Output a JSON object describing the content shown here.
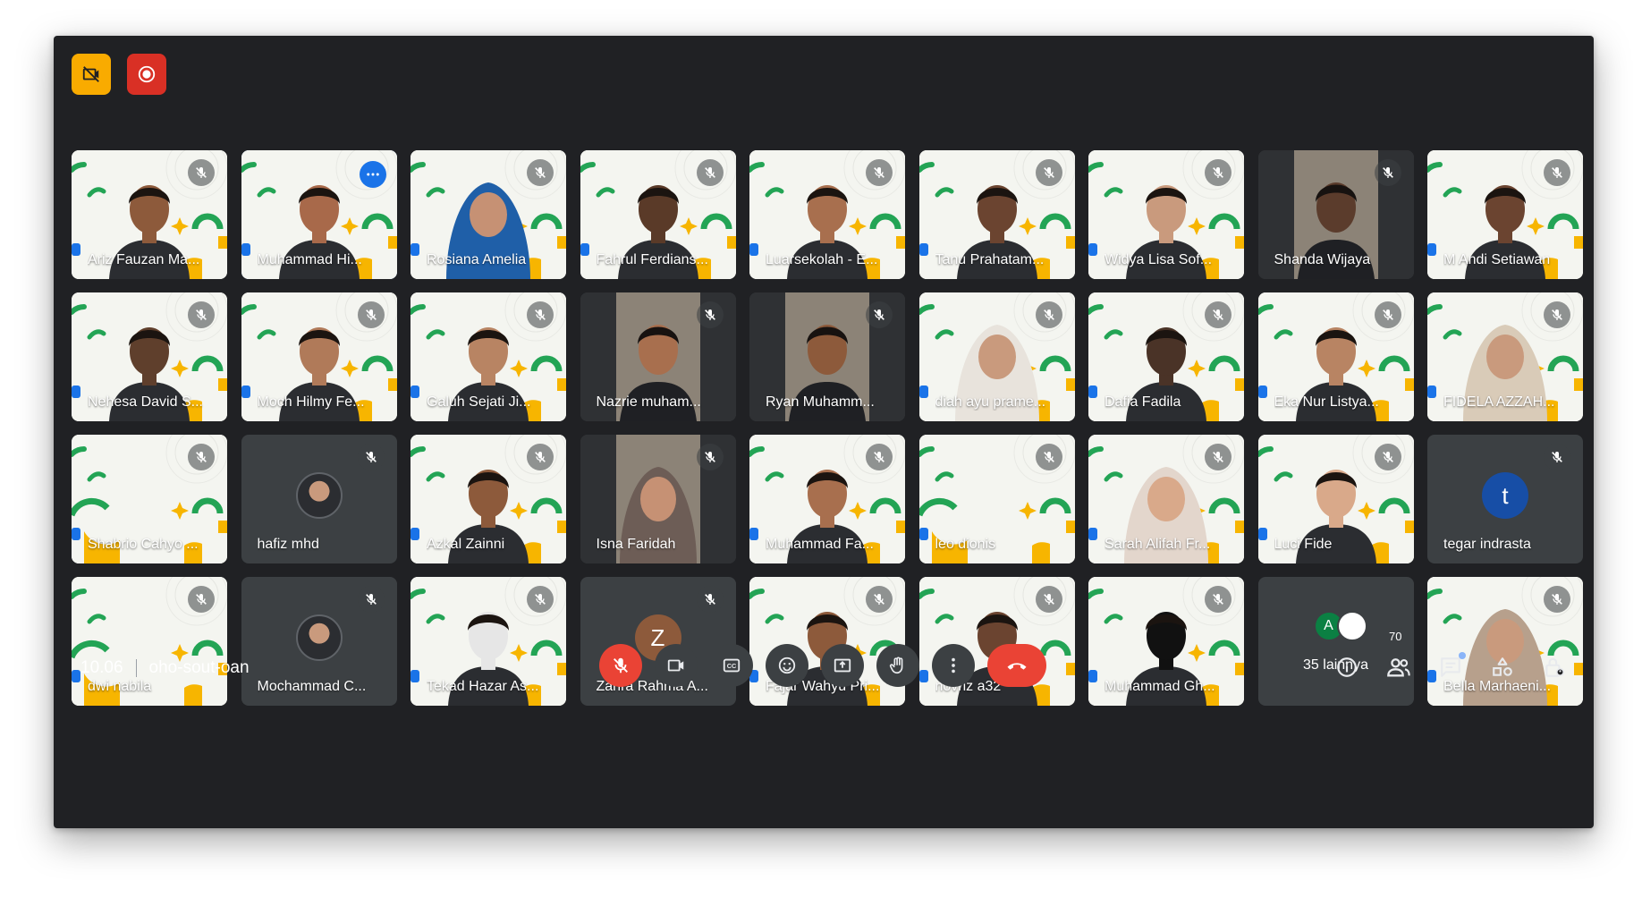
{
  "badges": {
    "yellow_icon": "recording-disabled-icon",
    "red_icon": "record-icon"
  },
  "participants": [
    {
      "name": "Ariz Fauzan Ma...",
      "bg": "brand",
      "state": "muted",
      "skin": "#8d5a3b"
    },
    {
      "name": "Muhammad Hi...",
      "bg": "brand",
      "state": "more",
      "active": true,
      "skin": "#a8694a"
    },
    {
      "name": "Rosiana Amelia",
      "bg": "brand",
      "state": "muted",
      "skin": "#c69174",
      "hijab": "#1f5fa8"
    },
    {
      "name": "Fahrul Ferdians...",
      "bg": "brand",
      "state": "muted",
      "skin": "#5a3a28"
    },
    {
      "name": "Luarsekolah - E...",
      "bg": "brand",
      "state": "muted",
      "skin": "#a86f4e"
    },
    {
      "name": "Tanu Prahatam...",
      "bg": "brand",
      "state": "muted",
      "skin": "#6b4430"
    },
    {
      "name": "Widya Lisa Sof...",
      "bg": "brand",
      "state": "muted",
      "skin": "#c99a7d"
    },
    {
      "name": "Shanda Wijaya",
      "bg": "photo",
      "state": "muted",
      "skin": "#5b3c2c"
    },
    {
      "name": "M Andi Setiawan",
      "bg": "brand",
      "state": "muted",
      "skin": "#6b4430"
    },
    {
      "name": "Nehesa David S...",
      "bg": "brand",
      "state": "muted",
      "skin": "#5f3f2c"
    },
    {
      "name": "Moch Hilmy Fe...",
      "bg": "brand",
      "state": "muted",
      "skin": "#b07a59"
    },
    {
      "name": "Galuh Sejati Ji...",
      "bg": "brand",
      "state": "muted",
      "skin": "#b88463"
    },
    {
      "name": "Nazrie muham...",
      "bg": "photo",
      "state": "muted",
      "skin": "#a86f4e"
    },
    {
      "name": "Ryan Muhamm...",
      "bg": "photo",
      "state": "muted",
      "skin": "#8d5a3b"
    },
    {
      "name": "diah ayu prame...",
      "bg": "brand",
      "state": "muted",
      "skin": "#c99a7d",
      "hijab": "#e8e3dc"
    },
    {
      "name": "Dafia Fadila",
      "bg": "brand",
      "state": "muted",
      "skin": "#4a3327"
    },
    {
      "name": "Eka Nur Listya...",
      "bg": "brand",
      "state": "muted",
      "skin": "#b88463"
    },
    {
      "name": "FIDELA AZZAH...",
      "bg": "brand",
      "state": "muted",
      "skin": "#c99a7d",
      "hijab": "#d9cbb8"
    },
    {
      "name": "Shabrio Cahyo ...",
      "bg": "brand",
      "state": "muted",
      "skin": null
    },
    {
      "name": "hafiz mhd",
      "bg": "dark",
      "state": "muted",
      "avatar": "photo"
    },
    {
      "name": "Azkal Zainni",
      "bg": "brand",
      "state": "muted",
      "skin": "#8d5a3b"
    },
    {
      "name": "Isna Faridah",
      "bg": "photo",
      "state": "muted",
      "skin": "#c69174",
      "hijab": "#6d5d56"
    },
    {
      "name": "Muhammad Fa...",
      "bg": "brand",
      "state": "muted",
      "skin": "#a86f4e"
    },
    {
      "name": "leo dionis",
      "bg": "brand",
      "state": "muted",
      "skin": null
    },
    {
      "name": "Sarah Alifah Fr...",
      "bg": "brand",
      "state": "muted",
      "skin": "#d9a98a",
      "hijab": "#e3d6cc"
    },
    {
      "name": "Luci Fide",
      "bg": "brand",
      "state": "muted",
      "skin": "#d9a98a"
    },
    {
      "name": "tegar indrasta",
      "bg": "dark",
      "state": "muted",
      "avatar": "letter",
      "letter": "t",
      "avatar_color": "#174ea6"
    },
    {
      "name": "dwi nabila",
      "bg": "brand",
      "state": "muted",
      "skin": null
    },
    {
      "name": "Mochammad C...",
      "bg": "dark",
      "state": "muted",
      "avatar": "photo"
    },
    {
      "name": "Tekad Hazar As...",
      "bg": "brand",
      "state": "muted",
      "skin": "#e6e6e6"
    },
    {
      "name": "Zahra Rahma A...",
      "bg": "dark",
      "state": "muted",
      "avatar": "letter",
      "letter": "Z",
      "avatar_color": "#8d5a3b"
    },
    {
      "name": "Fajar Wahyu Pri...",
      "bg": "brand",
      "state": "muted",
      "skin": "#8d5a3b"
    },
    {
      "name": "novriz a32",
      "bg": "brand",
      "state": "muted",
      "skin": "#6b4430"
    },
    {
      "name": "Muhammad Gh...",
      "bg": "brand",
      "state": "muted",
      "skin": "#111111"
    },
    {
      "name": "overflow",
      "bg": "dark",
      "state": "none",
      "overflow": true
    },
    {
      "name": "Bella Marhaeni...",
      "bg": "brand",
      "state": "muted",
      "skin": "#c99a7d",
      "hijab": "#b7a08c"
    }
  ],
  "overflow_tile": {
    "letter": "A",
    "label": "35 lainnya"
  },
  "meeting": {
    "time": "10.06",
    "code": "oho-sout-oan"
  },
  "controls": [
    {
      "name": "mic-toggle-button",
      "icon": "mic-off-icon",
      "style": "red"
    },
    {
      "name": "camera-toggle-button",
      "icon": "video-camera-icon",
      "style": "normal"
    },
    {
      "name": "captions-button",
      "icon": "closed-captions-icon",
      "style": "normal"
    },
    {
      "name": "reactions-button",
      "icon": "emoji-icon",
      "style": "normal"
    },
    {
      "name": "present-screen-button",
      "icon": "present-icon",
      "style": "normal"
    },
    {
      "name": "raise-hand-button",
      "icon": "hand-icon",
      "style": "normal"
    },
    {
      "name": "more-options-button",
      "icon": "more-vertical-icon",
      "style": "normal"
    },
    {
      "name": "leave-call-button",
      "icon": "call-end-icon",
      "style": "end"
    }
  ],
  "right_panel": {
    "people_count": "70"
  }
}
